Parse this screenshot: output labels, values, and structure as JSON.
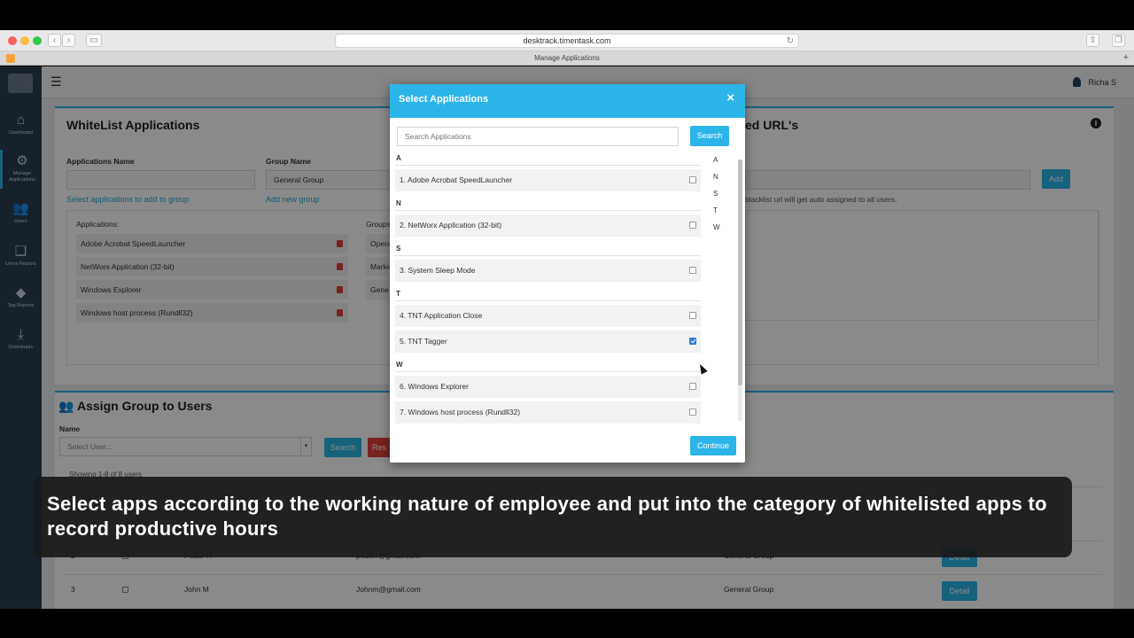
{
  "browser": {
    "url": "desktrack.timentask.com",
    "tab_title": "Manage Applications"
  },
  "sidebar": {
    "items": [
      {
        "label": "Dashboard",
        "icon": "home-icon"
      },
      {
        "label": "Manage Applications",
        "icon": "gears-icon"
      },
      {
        "label": "Users",
        "icon": "users-icon"
      },
      {
        "label": "Users Reports",
        "icon": "reports-icon"
      },
      {
        "label": "Tag Reports",
        "icon": "tags-icon"
      },
      {
        "label": "Downloads",
        "icon": "download-icon"
      }
    ]
  },
  "topbar": {
    "user_name": "Richa S"
  },
  "whitelist": {
    "title": "WhiteList Applications",
    "apps_label": "Applications Name",
    "group_label": "Group Name",
    "group_value": "General Group",
    "select_link": "Select applications to add to group",
    "add_group_link": "Add new group",
    "applications_header": "Applications:",
    "groups_header": "Groups",
    "applications": [
      "Adobe Acrobat SpeedLauncher",
      "NetWorx Application (32-bit)",
      "Windows Explorer",
      "Windows host process (Rundll32)"
    ],
    "groups_partial": [
      "Opera",
      "Marke",
      "Gene"
    ]
  },
  "blacklist": {
    "title_partial": "ed URL's",
    "add_button": "Add",
    "note": "blacklist url will get auto assigned to all users."
  },
  "assign": {
    "title": "Assign Group to Users",
    "name_label": "Name",
    "select_placeholder": "Select User...",
    "search_button": "Search",
    "reset_button": "Res",
    "showing": "Showing 1-8 of 8 users",
    "rows": [
      {
        "num": "2",
        "name": "Peder R",
        "email": "pederr@gmail.com",
        "group": "General Group",
        "action": "Detail"
      },
      {
        "num": "3",
        "name": "John M",
        "email": "Johnm@gmail.com",
        "group": "General Group",
        "action": "Detail"
      }
    ]
  },
  "modal": {
    "title": "Select Applications",
    "close": "×",
    "search_placeholder": "Search Applications",
    "search_button": "Search",
    "continue_button": "Continue",
    "alphabet": [
      "A",
      "N",
      "S",
      "T",
      "W"
    ],
    "groups": [
      {
        "letter": "A",
        "items": [
          {
            "label": "1. Adobe Acrobat SpeedLauncher",
            "checked": false
          }
        ]
      },
      {
        "letter": "N",
        "items": [
          {
            "label": "2. NetWorx Application (32-bit)",
            "checked": false
          }
        ]
      },
      {
        "letter": "S",
        "items": [
          {
            "label": "3. System Sleep Mode",
            "checked": false
          }
        ]
      },
      {
        "letter": "T",
        "items": [
          {
            "label": "4. TNT Application Close",
            "checked": false
          },
          {
            "label": "5. TNT Tagger",
            "checked": true
          }
        ]
      },
      {
        "letter": "W",
        "items": [
          {
            "label": "6. Windows Explorer",
            "checked": false
          },
          {
            "label": "7. Windows host process (Rundll32)",
            "checked": false
          }
        ]
      }
    ]
  },
  "caption": {
    "text": "Select apps according to the working nature of employee and put into the category of whitelisted apps to record productive hours"
  },
  "colors": {
    "accent": "#2cb5e8",
    "sidebar": "#2c3e50",
    "danger": "#e0403a",
    "checked": "#2f7fd9"
  }
}
